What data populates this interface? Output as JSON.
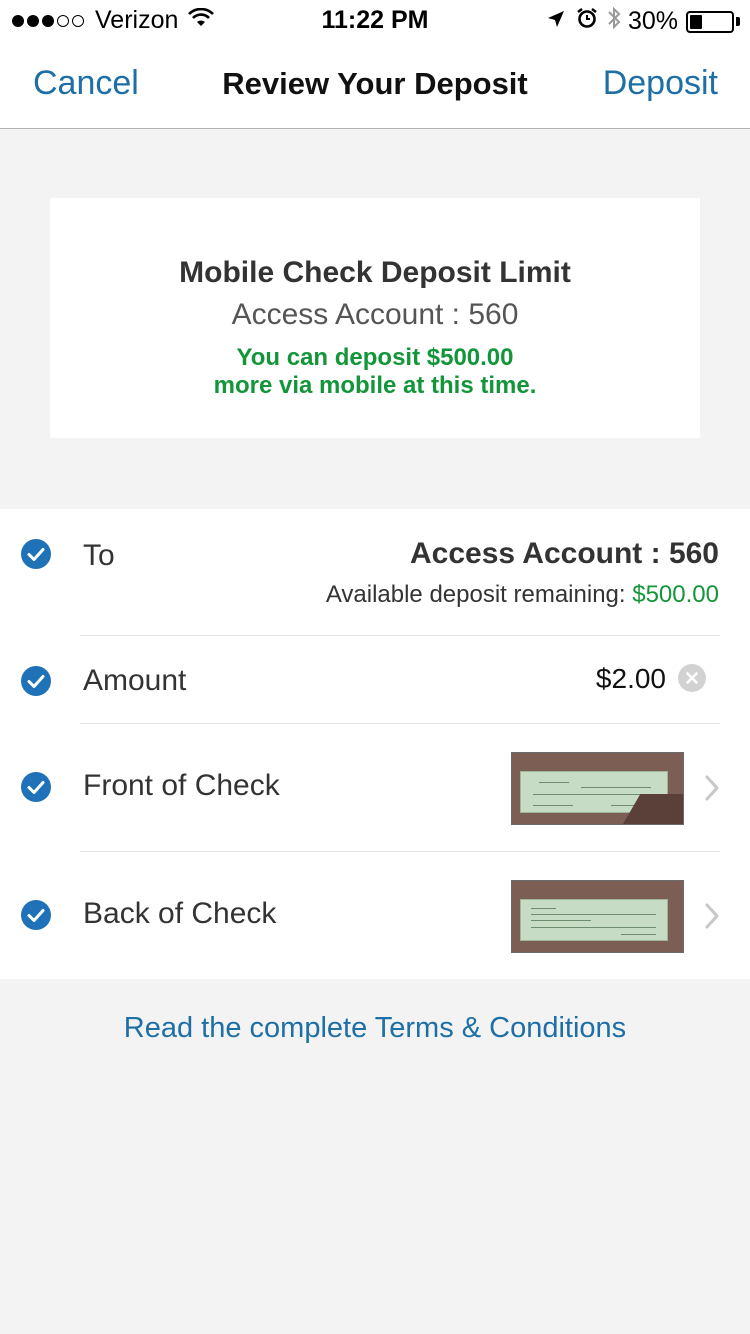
{
  "status_bar": {
    "carrier": "Verizon",
    "time": "11:22 PM",
    "battery_percent": "30%",
    "battery_level": 0.3,
    "signal_bars_filled": 3,
    "signal_bars_total": 5,
    "icons": [
      "wifi-icon",
      "location-arrow-icon",
      "alarm-icon",
      "bluetooth-icon",
      "battery-icon"
    ]
  },
  "nav": {
    "cancel_label": "Cancel",
    "title": "Review Your Deposit",
    "deposit_label": "Deposit"
  },
  "limit_card": {
    "title": "Mobile Check Deposit Limit",
    "account": "Access Account : 560",
    "message_line1": "You can deposit $500.00",
    "message_line2": "more via mobile at this time."
  },
  "rows": {
    "to": {
      "label": "To",
      "value": "Access Account : 560",
      "sub_label": "Available deposit remaining: ",
      "sub_amount": "$500.00"
    },
    "amount": {
      "label": "Amount",
      "value": "$2.00"
    },
    "front": {
      "label": "Front of Check"
    },
    "back": {
      "label": "Back of Check"
    }
  },
  "terms_link": "Read the complete Terms & Conditions",
  "colors": {
    "accent_blue": "#1d6fa5",
    "check_blue": "#1f72b8",
    "success_green": "#139639",
    "background": "#f3f3f3"
  }
}
